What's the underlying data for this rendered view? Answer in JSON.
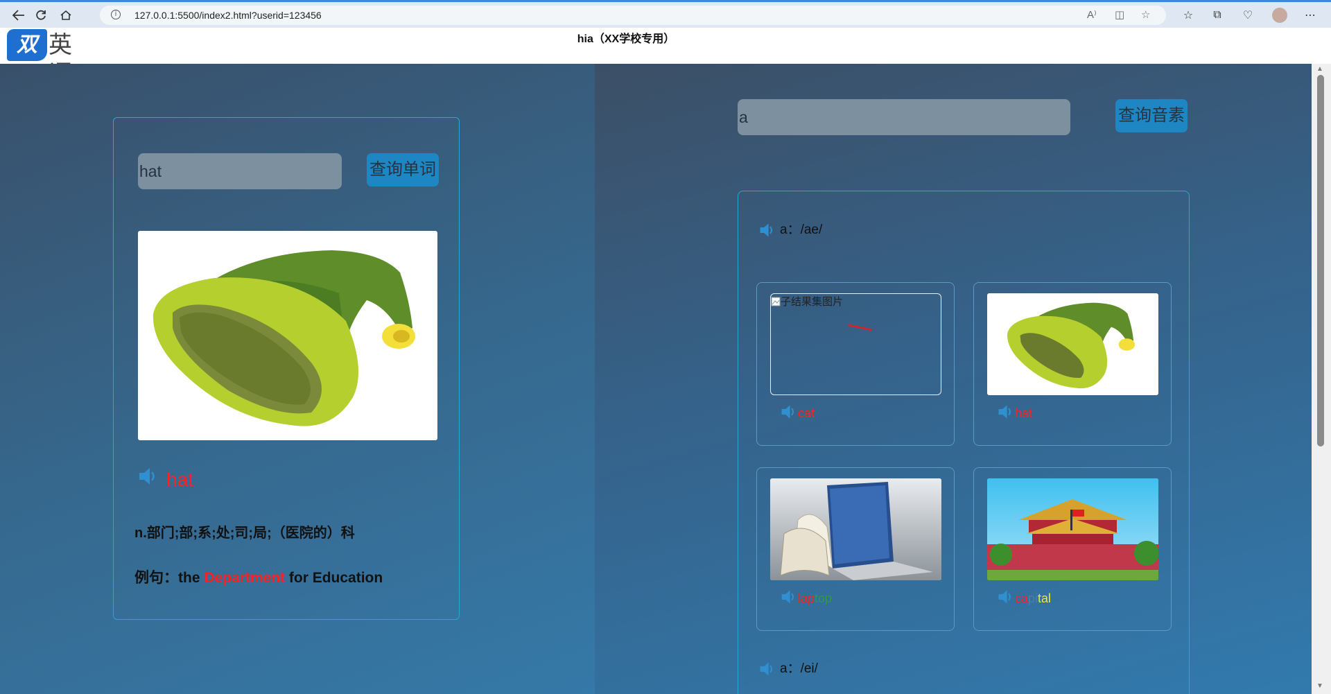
{
  "browser": {
    "url": "127.0.0.1:5500/index2.html?userid=123456"
  },
  "header": {
    "logo_mark": "双线",
    "logo_text": "英语",
    "title": "hia（XX学校专用）"
  },
  "word_panel": {
    "input_value": "hat",
    "search_button": "查询单词",
    "word": "hat",
    "definition": "n.部门;部;系;处;司;局;（医院的）科",
    "example_prefix": "例句：the ",
    "example_highlight": "Department",
    "example_suffix": " for Education"
  },
  "phoneme_panel": {
    "input_value": "a",
    "search_button": "查询音素",
    "sections": [
      {
        "label": "a：/ae/"
      },
      {
        "label": "a：/ei/"
      }
    ],
    "examples": [
      {
        "alt": "子结果集图片",
        "parts": [
          "cat"
        ]
      },
      {
        "parts": [
          "hat"
        ]
      },
      {
        "parts": [
          "lap",
          "top"
        ]
      },
      {
        "parts": [
          "ca",
          "pi",
          "tal"
        ]
      }
    ]
  },
  "colors": {
    "highlight": "#ff2020",
    "accent": "#1e86c3",
    "border": "#27a7d8"
  }
}
